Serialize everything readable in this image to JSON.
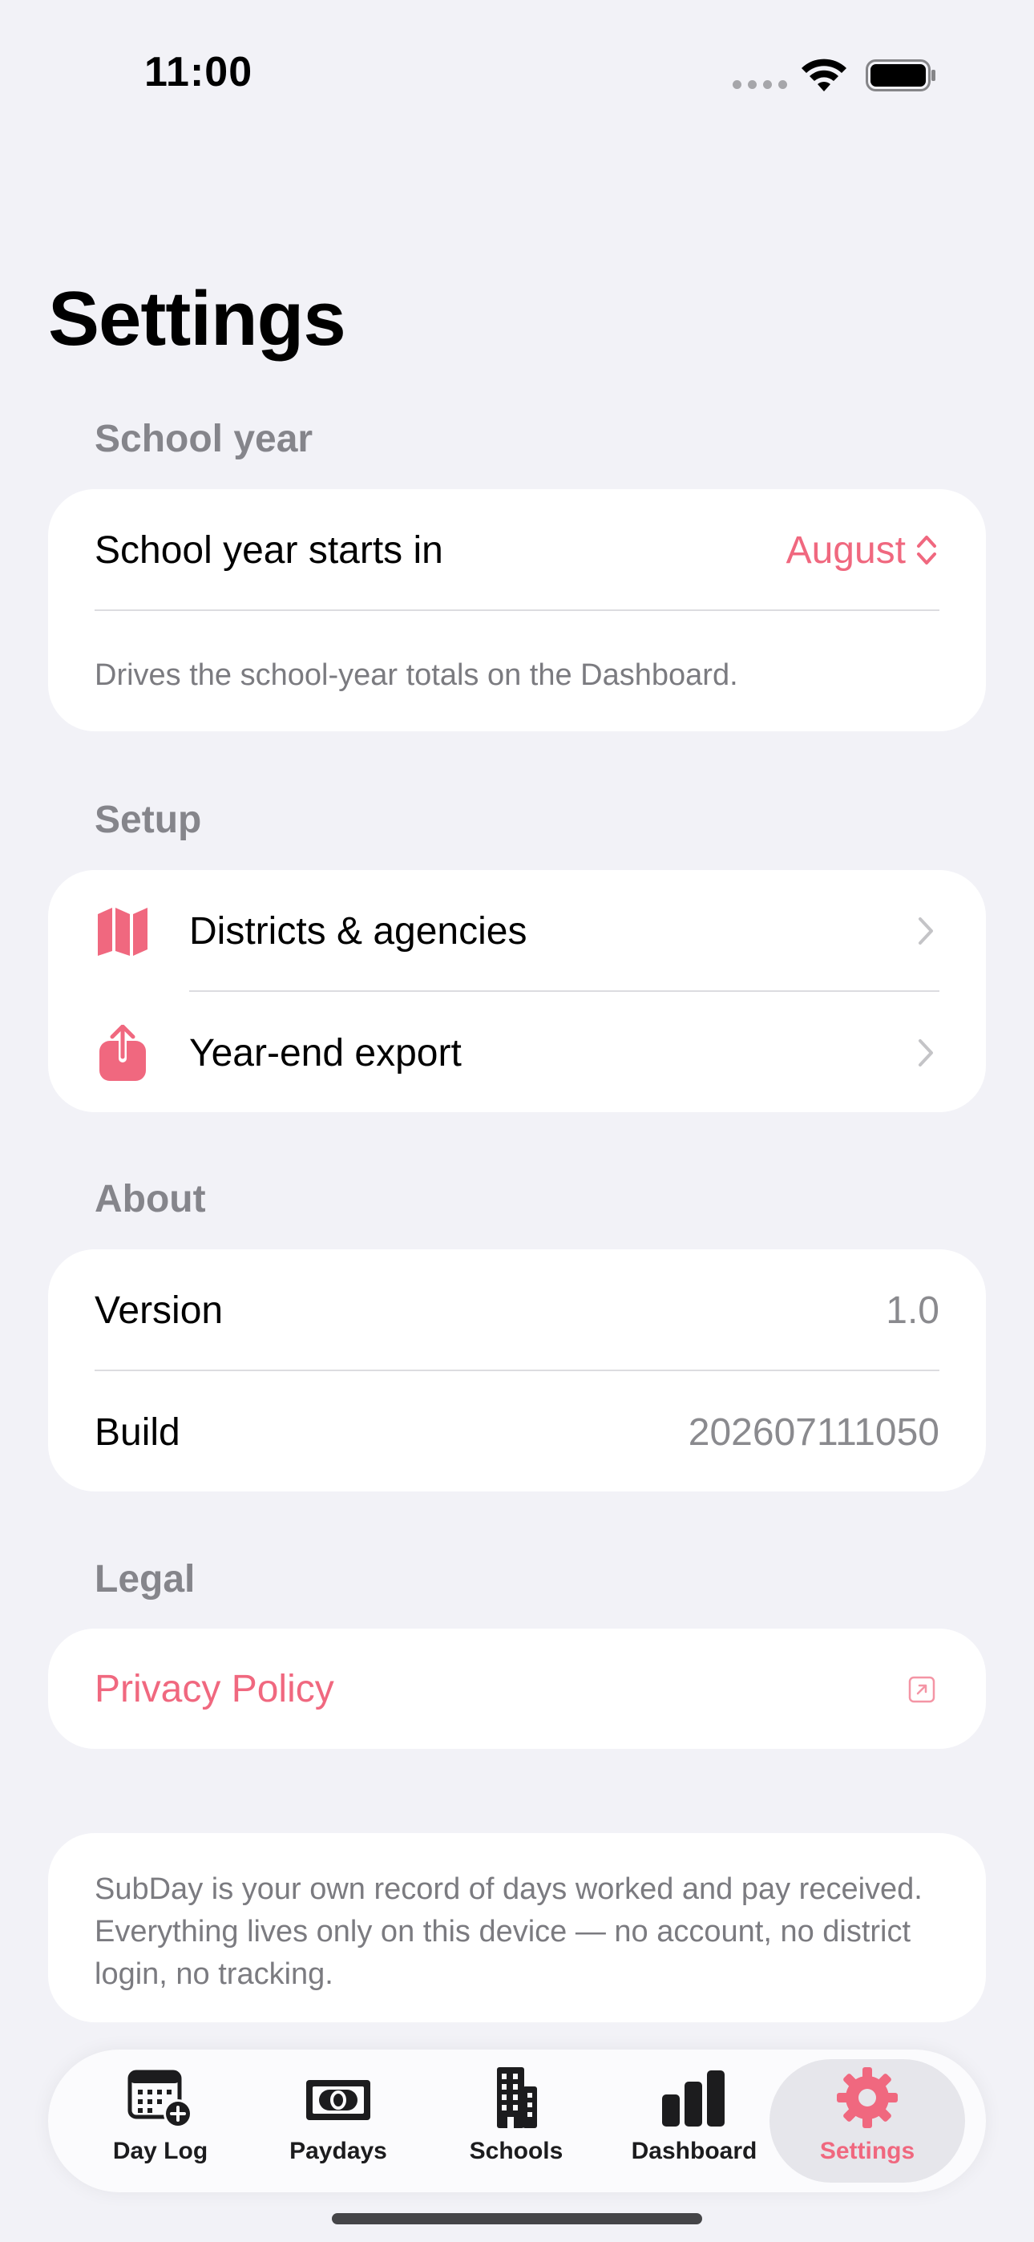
{
  "status_bar": {
    "time": "11:00"
  },
  "page": {
    "title": "Settings"
  },
  "sections": {
    "school_year": {
      "header": "School year",
      "row_label": "School year starts in",
      "row_value": "August",
      "footnote": "Drives the school-year totals on the Dashboard."
    },
    "setup": {
      "header": "Setup",
      "items": [
        {
          "label": "Districts & agencies",
          "icon": "map-icon"
        },
        {
          "label": "Year-end export",
          "icon": "share-icon"
        }
      ]
    },
    "about": {
      "header": "About",
      "version_label": "Version",
      "version_value": "1.0",
      "build_label": "Build",
      "build_value": "202607111050"
    },
    "legal": {
      "header": "Legal",
      "privacy_label": "Privacy Policy"
    }
  },
  "info_card": {
    "text": "SubDay is your own record of days worked and pay received. Everything lives only on this device — no account, no district login, no tracking."
  },
  "tab_bar": {
    "tabs": [
      {
        "label": "Day Log",
        "icon": "calendar-add-icon"
      },
      {
        "label": "Paydays",
        "icon": "banknote-icon"
      },
      {
        "label": "Schools",
        "icon": "building-icon"
      },
      {
        "label": "Dashboard",
        "icon": "bar-chart-icon"
      },
      {
        "label": "Settings",
        "icon": "gear-icon"
      }
    ],
    "active": "Settings"
  },
  "colors": {
    "accent": "#f0687f",
    "background": "#f2f2f7",
    "secondary_text": "#8a8a8e"
  }
}
